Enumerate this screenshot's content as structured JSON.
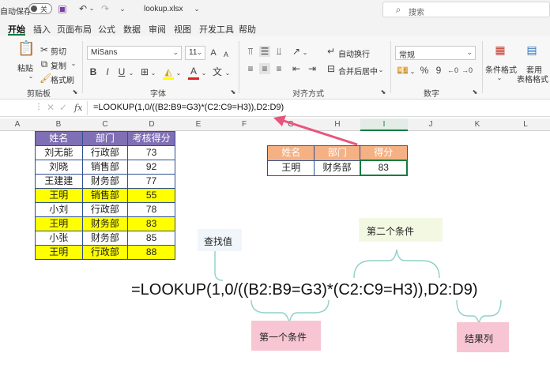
{
  "titlebar": {
    "autosave_label": "自动保存",
    "autosave_state": "关",
    "filename": "lookup.xlsx",
    "search_placeholder": "搜索"
  },
  "tabs": [
    "开始",
    "插入",
    "页面布局",
    "公式",
    "数据",
    "审阅",
    "视图",
    "开发工具",
    "帮助"
  ],
  "ribbon": {
    "clipboard": {
      "paste": "粘贴",
      "cut": "剪切",
      "copy": "复制",
      "painter": "格式刷",
      "group": "剪贴板"
    },
    "font": {
      "name": "MiSans",
      "size": "11",
      "bold": "B",
      "italic": "I",
      "underline": "U",
      "grow": "A",
      "shrink": "A",
      "color_glyph": "A",
      "group": "字体"
    },
    "alignment": {
      "wrap": "自动换行",
      "merge": "合并后居中",
      "group": "对齐方式"
    },
    "number": {
      "format": "常规",
      "percent": "%",
      "comma": "9",
      "group": "数字"
    },
    "styles": {
      "conditional": "条件格式",
      "table_format_1": "套用",
      "table_format_2": "表格格式"
    }
  },
  "formula_bar": {
    "formula": "=LOOKUP(1,0/((B2:B9=G3)*(C2:C9=H3)),D2:D9)"
  },
  "columns": [
    "A",
    "B",
    "C",
    "D",
    "E",
    "F",
    "G",
    "H",
    "I",
    "J",
    "K",
    "L"
  ],
  "data_table": {
    "headers": [
      "姓名",
      "部门",
      "考核得分"
    ],
    "rows": [
      {
        "name": "刘无能",
        "dept": "行政部",
        "score": "73",
        "highlight": false
      },
      {
        "name": "刘晓",
        "dept": "销售部",
        "score": "92",
        "highlight": false
      },
      {
        "name": "王建建",
        "dept": "财务部",
        "score": "77",
        "highlight": false
      },
      {
        "name": "王明",
        "dept": "销售部",
        "score": "55",
        "highlight": true
      },
      {
        "name": "小刘",
        "dept": "行政部",
        "score": "78",
        "highlight": false
      },
      {
        "name": "王明",
        "dept": "财务部",
        "score": "83",
        "highlight": true
      },
      {
        "name": "小张",
        "dept": "财务部",
        "score": "85",
        "highlight": false
      },
      {
        "name": "王明",
        "dept": "行政部",
        "score": "88",
        "highlight": true
      }
    ]
  },
  "lookup_table": {
    "headers": [
      "姓名",
      "部门",
      "得分"
    ],
    "row": {
      "name": "王明",
      "dept": "财务部",
      "score": "83"
    }
  },
  "annotations": {
    "lookup_value": "查找值",
    "condition_2": "第二个条件",
    "condition_1": "第一个条件",
    "result_col": "结果列",
    "big_formula": "=LOOKUP(1,0/((B2:B9=G3)*(C2:C9=H3)),D2:D9)"
  },
  "colors": {
    "header_purple": "#7f6fb5",
    "highlight_yellow": "#ffff00",
    "header_orange": "#f5b183",
    "arrow_pink": "#e8557a",
    "brace_teal": "#8fd1c7",
    "note_blue_bg": "#f0f6fb",
    "note_green_bg": "#f3f8e3",
    "note_pink_bg": "#f7c6d2",
    "accent_green": "#107c41"
  }
}
